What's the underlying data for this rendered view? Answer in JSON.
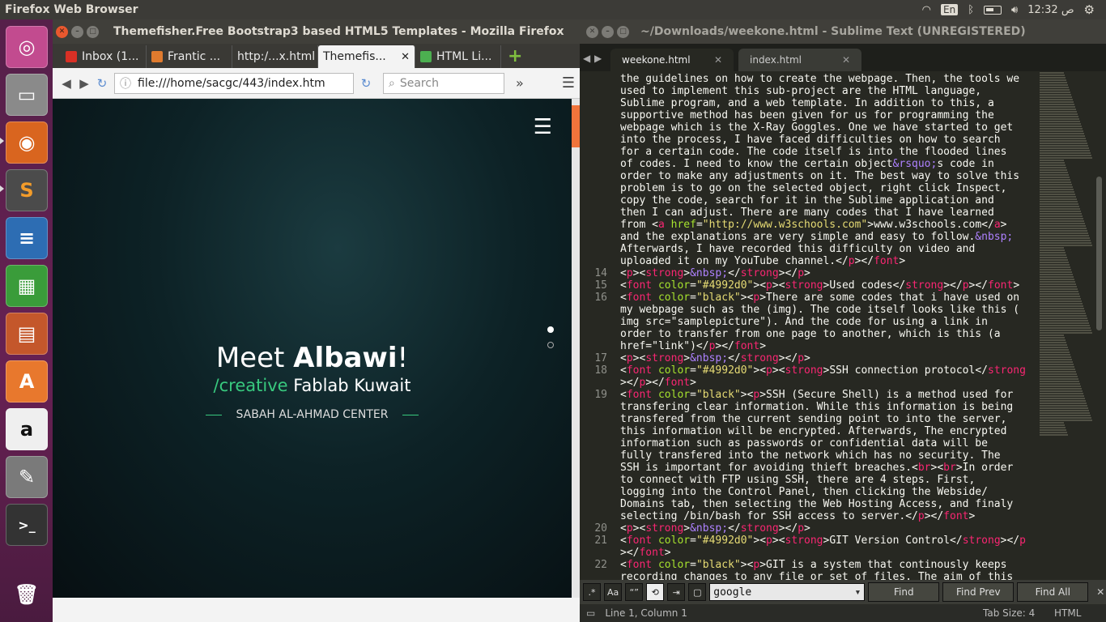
{
  "topbar": {
    "app_title": "Firefox Web Browser",
    "keyboard": "En",
    "clock": "12:32 ص"
  },
  "launcher": {
    "items": [
      "ubuntu-dash-icon",
      "files-icon",
      "firefox-icon",
      "sublime-text-icon",
      "writer-icon",
      "calc-icon",
      "impress-icon",
      "software-center-icon",
      "amazon-icon",
      "system-settings-icon",
      "terminal-icon",
      "trash-icon"
    ]
  },
  "firefox": {
    "title": "Themefisher.Free Bootstrap3 based HTML5 Templates - Mozilla Firefox",
    "tabs": [
      {
        "label": "Inbox (1...",
        "color": "#d93025"
      },
      {
        "label": "Frantic ...",
        "color": "#e07b2e"
      },
      {
        "label": "http:/...x.html",
        "color": ""
      },
      {
        "label": "Themefis...",
        "color": ""
      },
      {
        "label": "HTML Li...",
        "color": "#4caf50"
      }
    ],
    "url": "file:///home/sacgc/443/index.htm",
    "search_placeholder": "Search",
    "hero": {
      "meet": "Meet",
      "name": "Albawi",
      "exclaim": "!",
      "creative": "/creative",
      "place": " Fablab Kuwait",
      "center": "SABAH AL-AHMAD CENTER"
    }
  },
  "sublime": {
    "title": "~/Downloads/weekone.html - Sublime Text (UNREGISTERED)",
    "tabs": [
      "weekone.html",
      "index.html"
    ],
    "lines": [
      {
        "n": "",
        "html": "the guidelines on how to create the webpage. Then, the tools we"
      },
      {
        "n": "",
        "html": "used to implement this sub-project are the HTML language,"
      },
      {
        "n": "",
        "html": "Sublime program, and a web template. In addition to this, a"
      },
      {
        "n": "",
        "html": "supportive method has been given for us for programming the"
      },
      {
        "n": "",
        "html": "webpage which is the X-Ray Goggles. One we have started to get"
      },
      {
        "n": "",
        "html": "into the process, I have faced difficulties on how to search"
      },
      {
        "n": "",
        "html": "for a certain code. The code itself is into the flooded lines"
      },
      {
        "n": "",
        "html": "of codes. I need to know the certain object<span class='e'>&amp;rsquo;</span>s code in"
      },
      {
        "n": "",
        "html": "order to make any adjustments on it. The best way to solve this"
      },
      {
        "n": "",
        "html": "problem is to go on the selected object, right click Inspect,"
      },
      {
        "n": "",
        "html": "copy the code, search for it in the Sublime application and"
      },
      {
        "n": "",
        "html": "then I can adjust. There are many codes that I have learned"
      },
      {
        "n": "",
        "html": "from &lt;<span class='t'>a</span> <span class='a'>href</span>=<span class='s'>\"http://www.w3schools.com\"</span>&gt;www.w3schools.com&lt;/<span class='t'>a</span>&gt;"
      },
      {
        "n": "",
        "html": "and the explanations are very simple and easy to follow.<span class='e'>&amp;nbsp;</span>"
      },
      {
        "n": "",
        "html": "Afterwards, I have recorded this difficulty on video and"
      },
      {
        "n": "",
        "html": "uploaded it on my YouTube channel.&lt;/<span class='t'>p</span>&gt;&lt;/<span class='t'>font</span>&gt;"
      },
      {
        "n": "14",
        "html": "&lt;<span class='t'>p</span>&gt;&lt;<span class='t'>strong</span>&gt;<span class='e'>&amp;nbsp;</span>&lt;/<span class='t'>strong</span>&gt;&lt;/<span class='t'>p</span>&gt;"
      },
      {
        "n": "15",
        "html": "&lt;<span class='t'>font</span> <span class='a'>color</span>=<span class='s'>\"#4992d0\"</span>&gt;&lt;<span class='t'>p</span>&gt;&lt;<span class='t'>strong</span>&gt;Used codes&lt;/<span class='t'>strong</span>&gt;&lt;/<span class='t'>p</span>&gt;&lt;/<span class='t'>font</span>&gt;"
      },
      {
        "n": "16",
        "html": "&lt;<span class='t'>font</span> <span class='a'>color</span>=<span class='s'>\"black\"</span>&gt;&lt;<span class='t'>p</span>&gt;There are some codes that i have used on"
      },
      {
        "n": "",
        "html": "my webpage such as the (img). The code itself looks like this ("
      },
      {
        "n": "",
        "html": "img src=\"samplepicture\"). And the code for using a link in"
      },
      {
        "n": "",
        "html": "order to transfer from one page to another, which is this (a"
      },
      {
        "n": "",
        "html": "href=\"link\")&lt;/<span class='t'>p</span>&gt;&lt;/<span class='t'>font</span>&gt;"
      },
      {
        "n": "17",
        "html": "&lt;<span class='t'>p</span>&gt;&lt;<span class='t'>strong</span>&gt;<span class='e'>&amp;nbsp;</span>&lt;/<span class='t'>strong</span>&gt;&lt;/<span class='t'>p</span>&gt;"
      },
      {
        "n": "18",
        "html": "&lt;<span class='t'>font</span> <span class='a'>color</span>=<span class='s'>\"#4992d0\"</span>&gt;&lt;<span class='t'>p</span>&gt;&lt;<span class='t'>strong</span>&gt;SSH connection protocol&lt;/<span class='t'>strong</span>"
      },
      {
        "n": "",
        "html": "&gt;&lt;/<span class='t'>p</span>&gt;&lt;/<span class='t'>font</span>&gt;"
      },
      {
        "n": "19",
        "html": "&lt;<span class='t'>font</span> <span class='a'>color</span>=<span class='s'>\"black\"</span>&gt;&lt;<span class='t'>p</span>&gt;SSH (Secure Shell) is a method used for"
      },
      {
        "n": "",
        "html": "transfering clear information. While this information is being"
      },
      {
        "n": "",
        "html": "transfered from the current sending point to into the server,"
      },
      {
        "n": "",
        "html": "this information will be encrypted. Afterwards, The encrypted"
      },
      {
        "n": "",
        "html": "information such as passwords or confidential data will be"
      },
      {
        "n": "",
        "html": "fully transfered into the network which has no security. The"
      },
      {
        "n": "",
        "html": "SSH is important for avoiding thieft breaches.&lt;<span class='t'>br</span>&gt;&lt;<span class='t'>br</span>&gt;In order"
      },
      {
        "n": "",
        "html": "to connect with FTP using SSH, there are 4 steps. First,"
      },
      {
        "n": "",
        "html": "logging into the Control Panel, then clicking the Webside/"
      },
      {
        "n": "",
        "html": "Domains tab, then selecting the Web Hosting Access, and finaly"
      },
      {
        "n": "",
        "html": "selecting /bin/bash for SSH access to server.&lt;/<span class='t'>p</span>&gt;&lt;/<span class='t'>font</span>&gt;"
      },
      {
        "n": "20",
        "html": "&lt;<span class='t'>p</span>&gt;&lt;<span class='t'>strong</span>&gt;<span class='e'>&amp;nbsp;</span>&lt;/<span class='t'>strong</span>&gt;&lt;/<span class='t'>p</span>&gt;"
      },
      {
        "n": "21",
        "html": "&lt;<span class='t'>font</span> <span class='a'>color</span>=<span class='s'>\"#4992d0\"</span>&gt;&lt;<span class='t'>p</span>&gt;&lt;<span class='t'>strong</span>&gt;GIT Version Control&lt;/<span class='t'>strong</span>&gt;&lt;/<span class='t'>p</span>"
      },
      {
        "n": "",
        "html": "&gt;&lt;/<span class='t'>font</span>&gt;"
      },
      {
        "n": "22",
        "html": "&lt;<span class='t'>font</span> <span class='a'>color</span>=<span class='s'>\"black\"</span>&gt;&lt;<span class='t'>p</span>&gt;GIT is a system that continously keeps"
      },
      {
        "n": "",
        "html": "recording changes to any file or set of files. The aim of this"
      }
    ],
    "find": {
      "query": "google",
      "find_label": "Find",
      "find_prev_label": "Find Prev",
      "find_all_label": "Find All",
      "case_label": "Aa",
      "word_label": "“”",
      "regex_label": ".*"
    },
    "status": {
      "position": "Line 1, Column 1",
      "tab_size": "Tab Size: 4",
      "syntax": "HTML"
    }
  }
}
